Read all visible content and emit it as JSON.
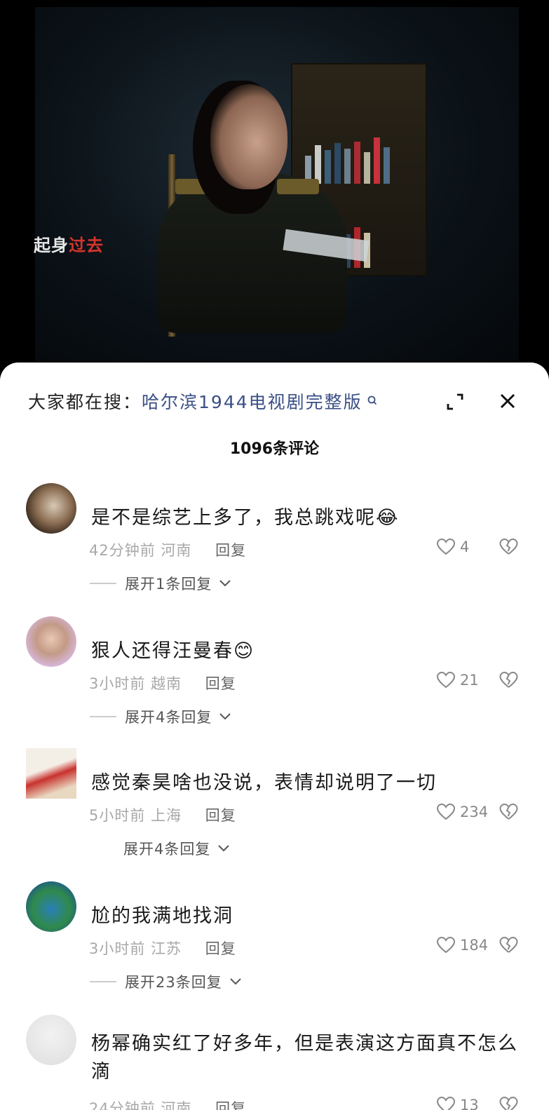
{
  "video": {
    "subtitle_white": "起身",
    "subtitle_red": "过去"
  },
  "sheet": {
    "search_prefix": "大家都在搜：",
    "search_link": "哈尔滨1944电视剧完整版",
    "count_title": "1096条评论"
  },
  "comments": [
    {
      "text": "是不是综艺上多了，我总跳戏呢😂",
      "time": "42分钟前",
      "location": "河南",
      "reply_label": "回复",
      "likes": "4",
      "expand_label": "展开1条回复"
    },
    {
      "text": "狠人还得汪曼春😊",
      "time": "3小时前",
      "location": "越南",
      "reply_label": "回复",
      "likes": "21",
      "expand_label": "展开4条回复"
    },
    {
      "text": "感觉秦昊啥也没说，表情却说明了一切",
      "time": "5小时前",
      "location": "上海",
      "reply_label": "回复",
      "likes": "234",
      "expand_label": "展开4条回复"
    },
    {
      "text": "尬的我满地找洞",
      "time": "3小时前",
      "location": "江苏",
      "reply_label": "回复",
      "likes": "184",
      "expand_label": "展开23条回复"
    },
    {
      "text": "杨幂确实红了好多年，但是表演这方面真不怎么滴",
      "time": "24分钟前",
      "location": "河南",
      "reply_label": "回复",
      "likes": "13"
    }
  ]
}
